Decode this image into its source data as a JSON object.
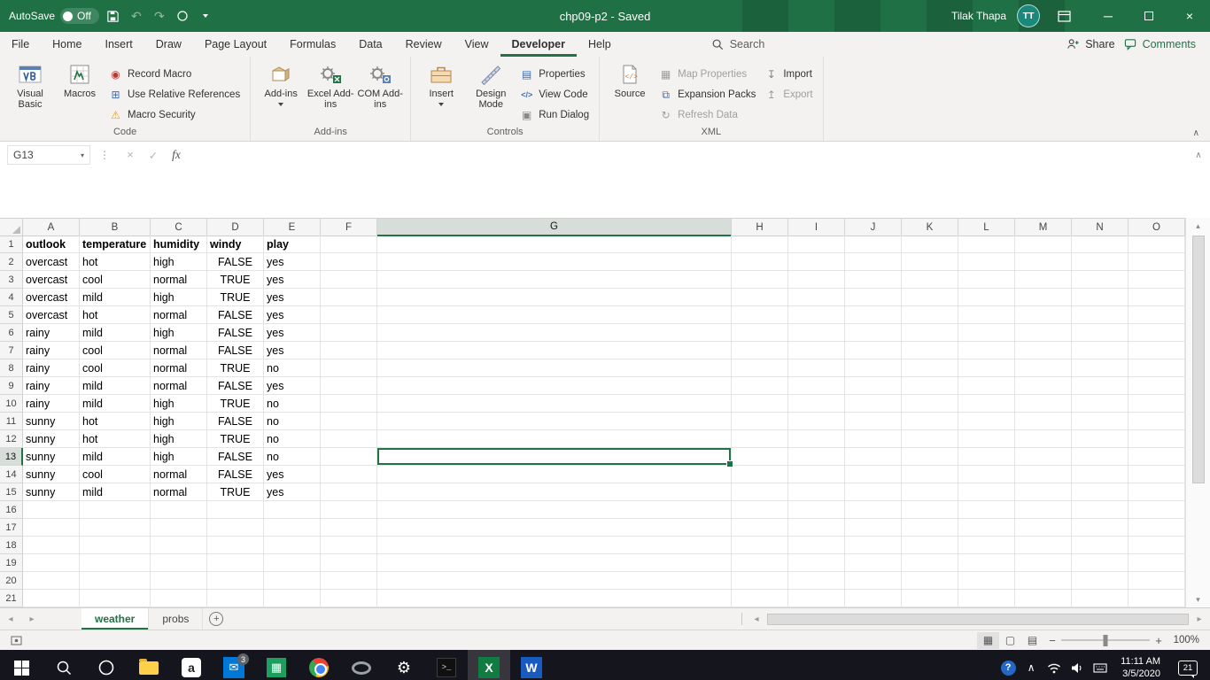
{
  "title_bar": {
    "autosave_label": "AutoSave",
    "autosave_state": "Off",
    "document_title": "chp09-p2 - Saved",
    "user_name": "Tilak Thapa",
    "user_initials": "TT"
  },
  "ribbon": {
    "tabs": [
      "File",
      "Home",
      "Insert",
      "Draw",
      "Page Layout",
      "Formulas",
      "Data",
      "Review",
      "View",
      "Developer",
      "Help"
    ],
    "active_tab": "Developer",
    "search_label": "Search",
    "share_label": "Share",
    "comments_label": "Comments",
    "groups": {
      "code": {
        "label": "Code",
        "visual_basic": "Visual Basic",
        "macros": "Macros",
        "record_macro": "Record Macro",
        "use_relative_references": "Use Relative References",
        "macro_security": "Macro Security"
      },
      "addins": {
        "label": "Add-ins",
        "addins": "Add-ins",
        "excel_addins": "Excel Add-ins",
        "com_addins": "COM Add-ins"
      },
      "controls": {
        "label": "Controls",
        "insert": "Insert",
        "design_mode": "Design Mode",
        "properties": "Properties",
        "view_code": "View Code",
        "run_dialog": "Run Dialog"
      },
      "xml": {
        "label": "XML",
        "source": "Source",
        "map_properties": "Map Properties",
        "expansion_packs": "Expansion Packs",
        "refresh_data": "Refresh Data",
        "import": "Import",
        "export": "Export"
      }
    }
  },
  "formula_bar": {
    "name_box": "G13",
    "formula": ""
  },
  "grid": {
    "columns": [
      "A",
      "B",
      "C",
      "D",
      "E",
      "F",
      "G",
      "H",
      "I",
      "J",
      "K",
      "L",
      "M",
      "N",
      "O"
    ],
    "selected_cell": "G13",
    "selected_column": "G",
    "selected_row": 13,
    "visible_row_count": 21,
    "header_row": [
      "outlook",
      "temperature",
      "humidity",
      "windy",
      "play"
    ],
    "data_rows": [
      [
        "overcast",
        "hot",
        "high",
        "FALSE",
        "yes"
      ],
      [
        "overcast",
        "cool",
        "normal",
        "TRUE",
        "yes"
      ],
      [
        "overcast",
        "mild",
        "high",
        "TRUE",
        "yes"
      ],
      [
        "overcast",
        "hot",
        "normal",
        "FALSE",
        "yes"
      ],
      [
        "rainy",
        "mild",
        "high",
        "FALSE",
        "yes"
      ],
      [
        "rainy",
        "cool",
        "normal",
        "FALSE",
        "yes"
      ],
      [
        "rainy",
        "cool",
        "normal",
        "TRUE",
        "no"
      ],
      [
        "rainy",
        "mild",
        "normal",
        "FALSE",
        "yes"
      ],
      [
        "rainy",
        "mild",
        "high",
        "TRUE",
        "no"
      ],
      [
        "sunny",
        "hot",
        "high",
        "FALSE",
        "no"
      ],
      [
        "sunny",
        "hot",
        "high",
        "TRUE",
        "no"
      ],
      [
        "sunny",
        "mild",
        "high",
        "FALSE",
        "no"
      ],
      [
        "sunny",
        "cool",
        "normal",
        "FALSE",
        "yes"
      ],
      [
        "sunny",
        "mild",
        "normal",
        "TRUE",
        "yes"
      ]
    ]
  },
  "sheet_tabs": {
    "tabs": [
      "weather",
      "probs"
    ],
    "active_tab": "weather"
  },
  "status_bar": {
    "zoom_level": "100%"
  },
  "taskbar": {
    "time": "11:11 AM",
    "date": "3/5/2020",
    "notification_count": "21",
    "mail_badge": "3"
  },
  "icons": {
    "close": "×",
    "minimize": "─",
    "undo": "↶",
    "redo": "↷",
    "cancel": "×",
    "enter": "✓",
    "fx": "fx",
    "dots": "⋮",
    "chevron_up": "∧",
    "arrow_left": "◂",
    "arrow_right": "▸",
    "arrow_up": "▴",
    "arrow_down": "▾",
    "plus": "+",
    "minus": "−",
    "record": "◉",
    "grid_plus": "⊞",
    "warning": "⚠",
    "properties": "▤",
    "code": "</>",
    "run": "▣",
    "map": "▦",
    "packs": "⧉",
    "refresh": "↻",
    "import": "↧",
    "export": "↥",
    "view_normal": "▦",
    "view_layout": "▢",
    "view_break": "▤",
    "question": "?",
    "letter_a": "a",
    "envelope": "✉",
    "sheet_grid": "▦",
    "cmd_prompt": "&gt;_",
    "excel_x": "X",
    "word_w": "W",
    "gear": "⚙"
  }
}
